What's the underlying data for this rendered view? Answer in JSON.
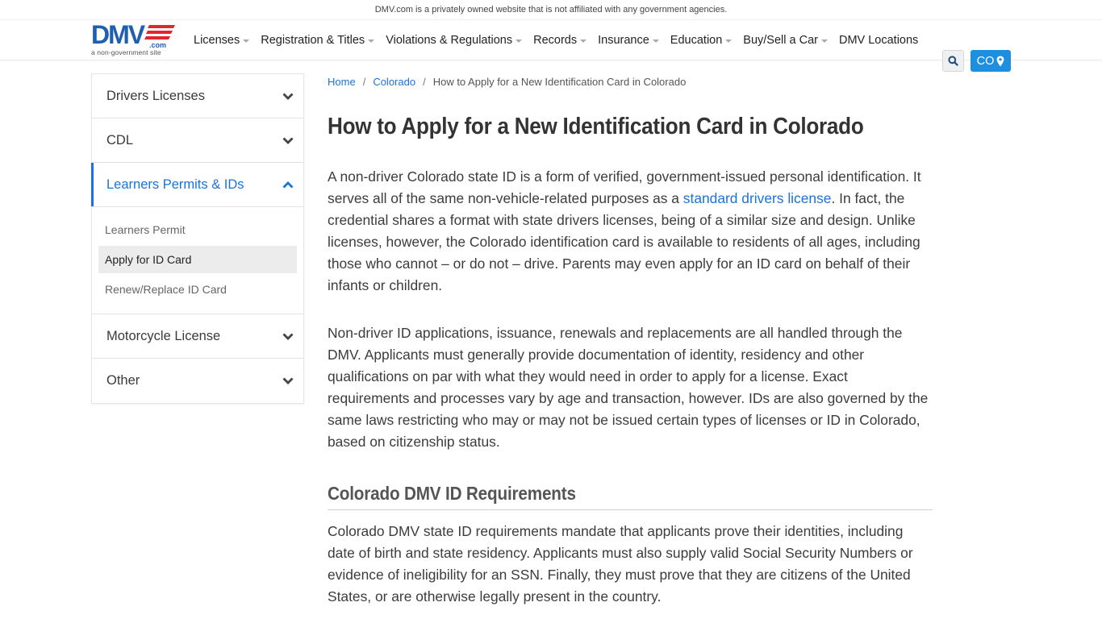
{
  "topbar": {
    "disclaimer": "DMV.com is a privately owned website that is not affiliated with any government agencies."
  },
  "header": {
    "logo": {
      "text": "DMV",
      "suffix": ".com",
      "tagline": "a non-government site",
      "colors": {
        "blue": "#1f5fae",
        "red": "#e0262e"
      }
    },
    "nav": [
      {
        "label": "Licenses",
        "dropdown": true
      },
      {
        "label": "Registration & Titles",
        "dropdown": true
      },
      {
        "label": "Violations & Regulations",
        "dropdown": true
      },
      {
        "label": "Records",
        "dropdown": true
      },
      {
        "label": "Insurance",
        "dropdown": true
      },
      {
        "label": "Education",
        "dropdown": true
      },
      {
        "label": "Buy/Sell a Car",
        "dropdown": true
      },
      {
        "label": "DMV Locations",
        "dropdown": false
      }
    ],
    "search_icon": "search-icon",
    "state_button": {
      "label": "CO",
      "icon": "map-marker-icon",
      "color": "#1e8fe0"
    }
  },
  "sidebar": {
    "sections": [
      {
        "label": "Drivers Licenses",
        "expanded": false
      },
      {
        "label": "CDL",
        "expanded": false
      },
      {
        "label": "Learners Permits & IDs",
        "expanded": true,
        "items": [
          {
            "label": "Learners Permit",
            "selected": false
          },
          {
            "label": "Apply for ID Card",
            "selected": true
          },
          {
            "label": "Renew/Replace ID Card",
            "selected": false
          }
        ]
      },
      {
        "label": "Motorcycle License",
        "expanded": false
      },
      {
        "label": "Other",
        "expanded": false
      }
    ],
    "accent": "#1a73d9"
  },
  "breadcrumb": {
    "items": [
      "Home",
      "Colorado"
    ],
    "current": "How to Apply for a New Identification Card in Colorado",
    "separator": "/"
  },
  "article": {
    "title": "How to Apply for a New Identification Card in Colorado",
    "p1_before_link": "A non-driver Colorado state ID is a form of verified, government-issued personal identification. It serves all of the same non-vehicle-related purposes as a ",
    "p1_link": "standard drivers license",
    "p1_after_link": ". In fact, the credential shares a format with state drivers licenses, being of a similar size and design. Unlike licenses, however, the Colorado identification card is available to residents of all ages, including those who cannot – or do not – drive. Parents may even apply for an ID card on behalf of their infants or children.",
    "p2": "Non-driver ID applications, issuance, renewals and replacements are all handled through the DMV. Applicants must generally provide documentation of identity, residency and other qualifications on par with what they would need in order to apply for a license. Exact requirements and processes vary by age and transaction, however. IDs are also governed by the same laws restricting who may or may not be issued certain types of licenses or ID in Colorado, based on citizenship status.",
    "h2": "Colorado DMV ID Requirements",
    "p3": "Colorado DMV state ID requirements mandate that applicants prove their identities, including date of birth and state residency. Applicants must also supply valid Social Security Numbers or evidence of ineligibility for an SSN. Finally, they must prove that they are citizens of the United States, or are otherwise legally present in the country."
  }
}
